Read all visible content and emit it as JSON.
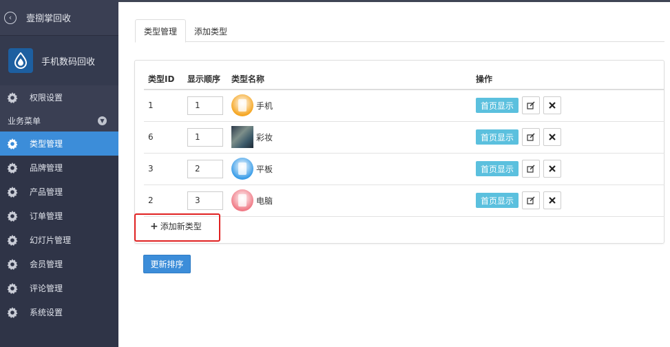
{
  "sidebar": {
    "back_label": "壹捌掌回收",
    "app_name": "手机数码回收",
    "perm_label": "权限设置",
    "section_label": "业务菜单",
    "items": [
      {
        "label": "类型管理",
        "active": true
      },
      {
        "label": "品牌管理"
      },
      {
        "label": "产品管理"
      },
      {
        "label": "订单管理"
      },
      {
        "label": "幻灯片管理"
      },
      {
        "label": "会员管理"
      },
      {
        "label": "评论管理"
      },
      {
        "label": "系统设置"
      }
    ]
  },
  "tabs": [
    {
      "label": "类型管理",
      "active": true
    },
    {
      "label": "添加类型"
    }
  ],
  "table": {
    "headers": {
      "id": "类型ID",
      "order": "显示顺序",
      "name": "类型名称",
      "actions": "操作"
    },
    "rows": [
      {
        "id": "1",
        "order": "1",
        "name": "手机",
        "icon": "phone-icon",
        "color": "#f5a623"
      },
      {
        "id": "6",
        "order": "1",
        "name": "彩妆",
        "icon": "makeup-image",
        "color": "#4a5a6a"
      },
      {
        "id": "3",
        "order": "2",
        "name": "平板",
        "icon": "tablet-icon",
        "color": "#3a9de8"
      },
      {
        "id": "2",
        "order": "3",
        "name": "电脑",
        "icon": "laptop-icon",
        "color": "#f07a86"
      }
    ],
    "home_button_label": "首页显示"
  },
  "add_new_label": "添加新类型",
  "update_sort_label": "更新排序",
  "colors": {
    "sidebar_bg": "#2f3447",
    "accent": "#3c8dd9",
    "info": "#5bc0de",
    "highlight": "#e02020"
  }
}
